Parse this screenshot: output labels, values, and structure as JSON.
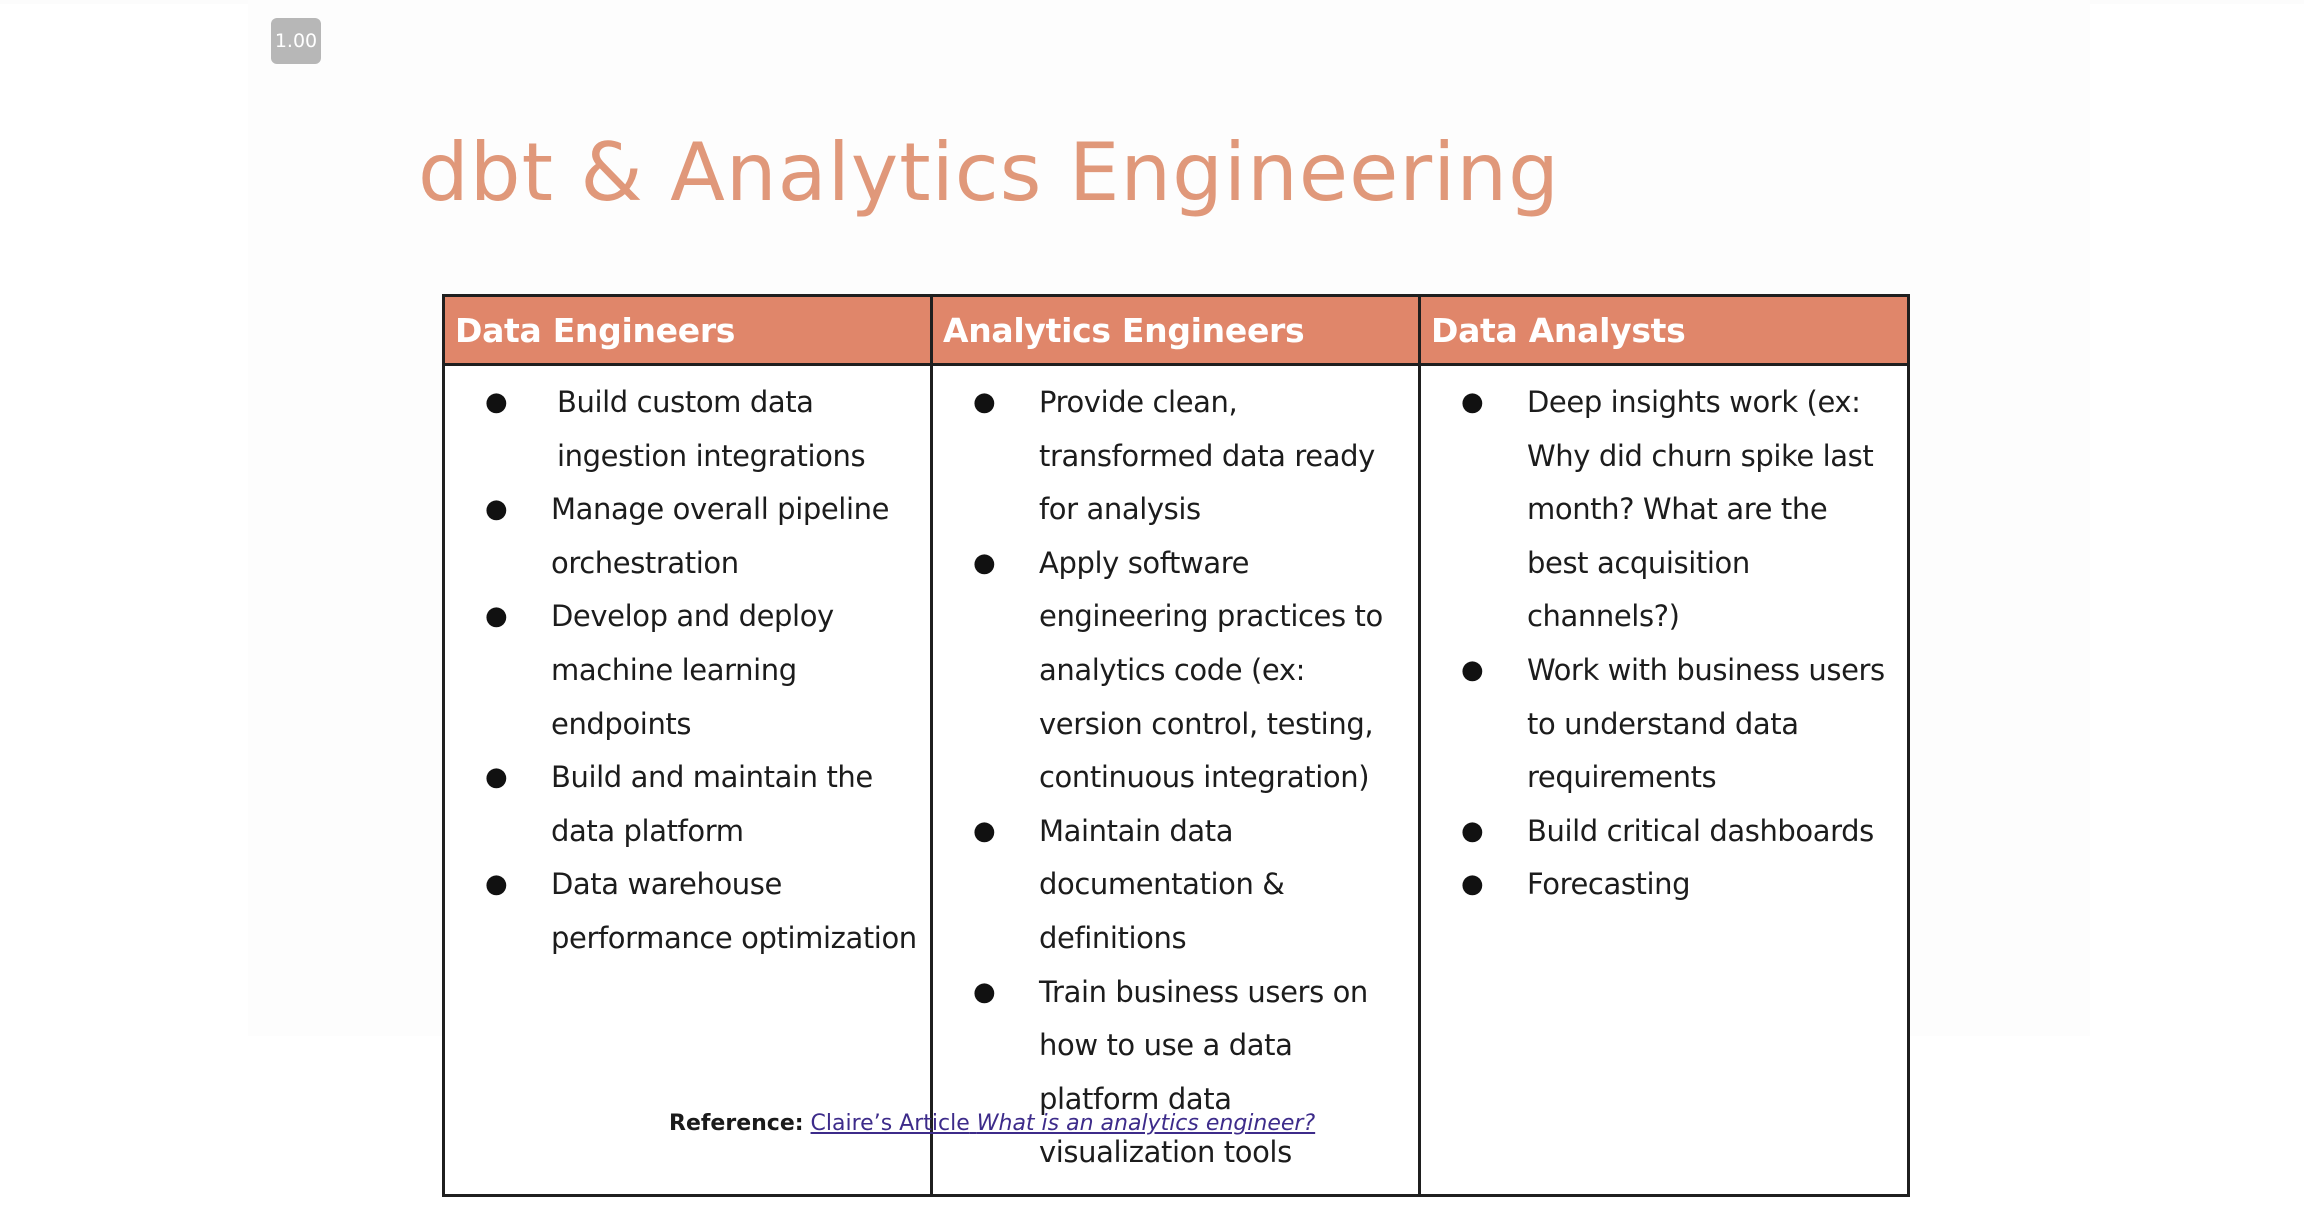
{
  "zoom_badge": "1.00",
  "slide": {
    "title": "dbt & Analytics Engineering",
    "columns": [
      {
        "heading": "Data Engineers",
        "items": [
          "Build custom data ingestion integrations",
          "Manage overall pipeline orchestration",
          "Develop and deploy machine learning endpoints",
          "Build and maintain the data platform",
          "Data warehouse performance optimization"
        ]
      },
      {
        "heading": "Analytics Engineers",
        "items": [
          "Provide clean, transformed data ready for analysis",
          "Apply software engineering practices to analytics code (ex: version control, testing, continuous integration)",
          "Maintain data documentation & definitions",
          "Train business users on how to use a data platform data visualization tools"
        ]
      },
      {
        "heading": "Data Analysts",
        "items": [
          "Deep insights work (ex: Why did churn spike last month? What are the best acquisition channels?)",
          "Work with business users to understand data requirements",
          "Build critical dashboards",
          "Forecasting"
        ]
      }
    ],
    "bullet_glyph": "●"
  },
  "reference": {
    "label": "Reference:",
    "link_prefix": "Claire’s Article",
    "link_title": "What is an analytics engineer?"
  },
  "colors": {
    "title": "#e0987a",
    "header_fill": "#e0866a",
    "link": "#3d2b8a"
  }
}
